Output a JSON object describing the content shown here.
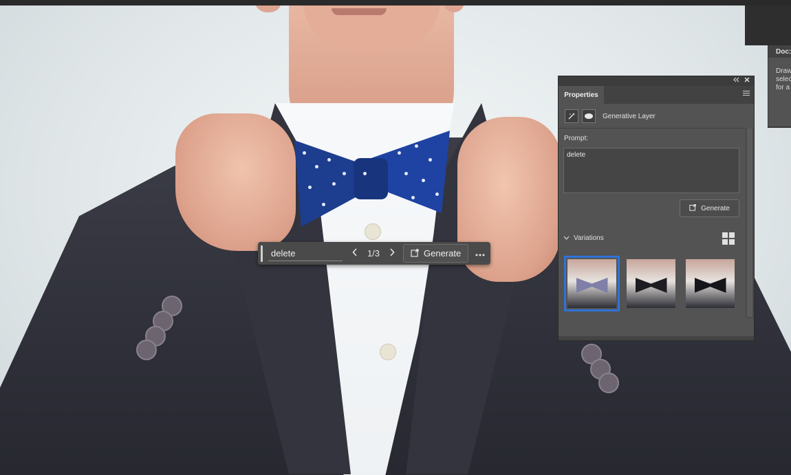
{
  "taskbar": {
    "prompt_value": "delete",
    "prev_icon": "chevron-left-icon",
    "counter": "1/3",
    "next_icon": "chevron-right-icon",
    "generate_label": "Generate",
    "generate_icon": "generate-icon",
    "more_icon": "more-icon"
  },
  "doc_panel": {
    "title": "Doc:",
    "lines": [
      "Draw",
      "selec",
      "for a"
    ]
  },
  "properties": {
    "tab_label": "Properties",
    "collapse_icon": "double-chevron-left-icon",
    "close_icon": "close-icon",
    "menu_icon": "panel-menu-icon",
    "layer_icon": "generative-layer-icon",
    "mask_icon": "mask-icon",
    "layer_name": "Generative Layer",
    "prompt_label": "Prompt:",
    "prompt_value": "delete",
    "generate_label": "Generate",
    "variations_label": "Variations",
    "grid_icon": "grid-view-icon",
    "variations": [
      {
        "name": "variation-1",
        "selected": true,
        "tie_color": "#7f7fa8"
      },
      {
        "name": "variation-2",
        "selected": false,
        "tie_color": "#1d1d22"
      },
      {
        "name": "variation-3",
        "selected": false,
        "tie_color": "#15151a"
      }
    ]
  },
  "colors": {
    "selection_accent": "#2f73d8",
    "panel_bg": "#535353",
    "bowtie_blue": "#1f43a3"
  }
}
